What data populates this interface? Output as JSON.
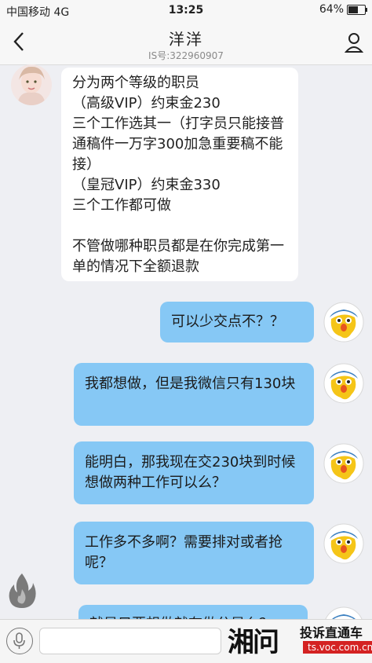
{
  "status_bar": {
    "carrier": "中国移动 4G",
    "time": "13:25",
    "battery": "64%",
    "battery_level": 0.64
  },
  "nav": {
    "title": "洋洋",
    "subtitle": "IS号:322960907"
  },
  "messages": [
    {
      "direction": "in",
      "text": "分为两个等级的职员\n（高级VIP）约束金230\n三个工作选其一（打字员只能接普通稿件一万字300加急重要稿不能接）\n（皇冠VIP）约束金330\n三个工作都可做\n\n不管做哪种职员都是在你完成第一单的情况下全额退款"
    },
    {
      "direction": "out",
      "text": "可以少交点不？？"
    },
    {
      "direction": "out",
      "text": "我都想做，但是我微信只有130块"
    },
    {
      "direction": "out",
      "text": "能明白，那我现在交230块到时候想做两种工作可以么？"
    },
    {
      "direction": "out",
      "text": "工作多不多啊？需要排对或者抢呢？"
    },
    {
      "direction": "out",
      "text": "就是只要想做就有做分是么？"
    }
  ],
  "watermark": {
    "logo": "湘问",
    "title": "投诉直通车",
    "url": "ts.voc.com.cn"
  },
  "icons": {
    "back": "back-arrow-icon",
    "profile": "profile-icon",
    "fire": "fire-icon",
    "mic": "microphone-icon",
    "self_avatar": "yellow-bird-avatar"
  },
  "colors": {
    "incoming_bubble": "#ffffff",
    "outgoing_bubble": "#86c8f5",
    "background": "#eeeff3"
  }
}
